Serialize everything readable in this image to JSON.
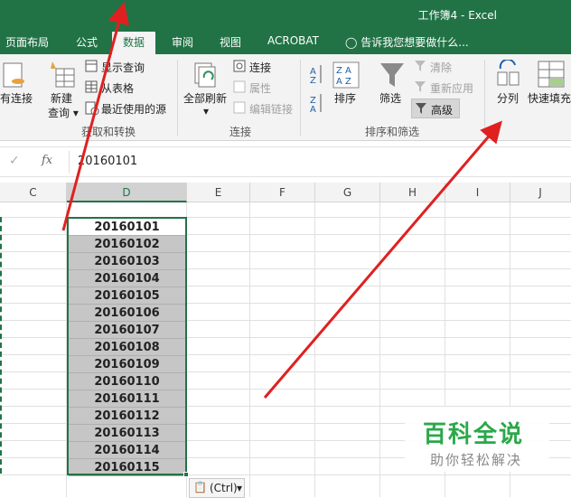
{
  "window": {
    "title": "工作簿4 - Excel"
  },
  "tabs": [
    "页面布局",
    "公式",
    "数据",
    "审阅",
    "视图",
    "ACROBAT"
  ],
  "active_tab": "数据",
  "tell_me": "告诉我您想要做什么...",
  "ribbon": {
    "existing_connections": "有连接",
    "new_query": "新建\n查询",
    "show_queries": "显示查询",
    "from_table": "从表格",
    "recent_sources": "最近使用的源",
    "group_get_transform": "获取和转换",
    "refresh_all": "全部刷新",
    "connections": "连接",
    "properties": "属性",
    "edit_links": "编辑链接",
    "group_connections": "连接",
    "sort": "排序",
    "filter": "筛选",
    "clear": "清除",
    "reapply": "重新应用",
    "advanced": "高级",
    "group_sort_filter": "排序和筛选",
    "text_to_columns": "分列",
    "flash_fill": "快速填充"
  },
  "formula_bar": {
    "value": "20160101"
  },
  "columns": [
    "C",
    "D",
    "E",
    "F",
    "G",
    "H",
    "I",
    "J"
  ],
  "selected_column": "D",
  "cells": [
    "20160101",
    "20160102",
    "20160103",
    "20160104",
    "20160105",
    "20160106",
    "20160107",
    "20160108",
    "20160109",
    "20160110",
    "20160111",
    "20160112",
    "20160113",
    "20160114",
    "20160115"
  ],
  "paste_options": "(Ctrl)",
  "watermark": {
    "main": "百科全说",
    "sub": "助你轻松解决"
  },
  "colors": {
    "excel_green": "#217346",
    "arrow_red": "#e02020",
    "watermark_green": "#2aa84a"
  }
}
